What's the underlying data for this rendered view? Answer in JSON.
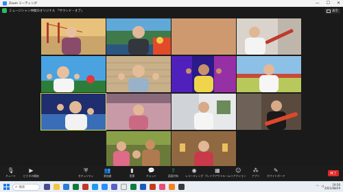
{
  "window": {
    "title": "Zoom ミーティング",
    "minimize": "—",
    "maximize": "☐",
    "close": "✕"
  },
  "meeting": {
    "name": "ミュージシャン仲間のオリジナル 「サウンド・オブ」",
    "view_label": "表示"
  },
  "toolbar": {
    "items": [
      {
        "label": "ミュート",
        "icon": "mic-icon",
        "glyph": "🎙"
      },
      {
        "label": "ビデオの開始",
        "icon": "video-icon",
        "glyph": "▶"
      },
      {
        "label": "セキュリティ",
        "icon": "shield-icon",
        "glyph": "⛨"
      },
      {
        "label": "参加者",
        "icon": "participants-icon",
        "glyph": "👥"
      },
      {
        "label": "投票",
        "icon": "poll-icon",
        "glyph": "▮"
      },
      {
        "label": "チャット",
        "icon": "chat-icon",
        "glyph": "💬"
      },
      {
        "label": "画面共有",
        "icon": "share-screen-icon",
        "glyph": "⇧"
      },
      {
        "label": "レコーディング",
        "icon": "record-icon",
        "glyph": "◉"
      },
      {
        "label": "ブレイクアウトルーム",
        "icon": "breakout-icon",
        "glyph": "▦"
      },
      {
        "label": "リアクション",
        "icon": "reaction-icon",
        "glyph": "☺"
      },
      {
        "label": "アプリ",
        "icon": "apps-icon",
        "glyph": "⁂"
      },
      {
        "label": "ホワイトボード",
        "icon": "whiteboard-icon",
        "glyph": "✎"
      }
    ],
    "end_label": "終了"
  },
  "taskbar": {
    "search_placeholder": "検索",
    "time": "19:56",
    "date": "2021/08/29"
  },
  "colors": {
    "speaking_border": "#d7e23f",
    "end_button": "#e02828",
    "share_icon": "#2bbd5e"
  }
}
